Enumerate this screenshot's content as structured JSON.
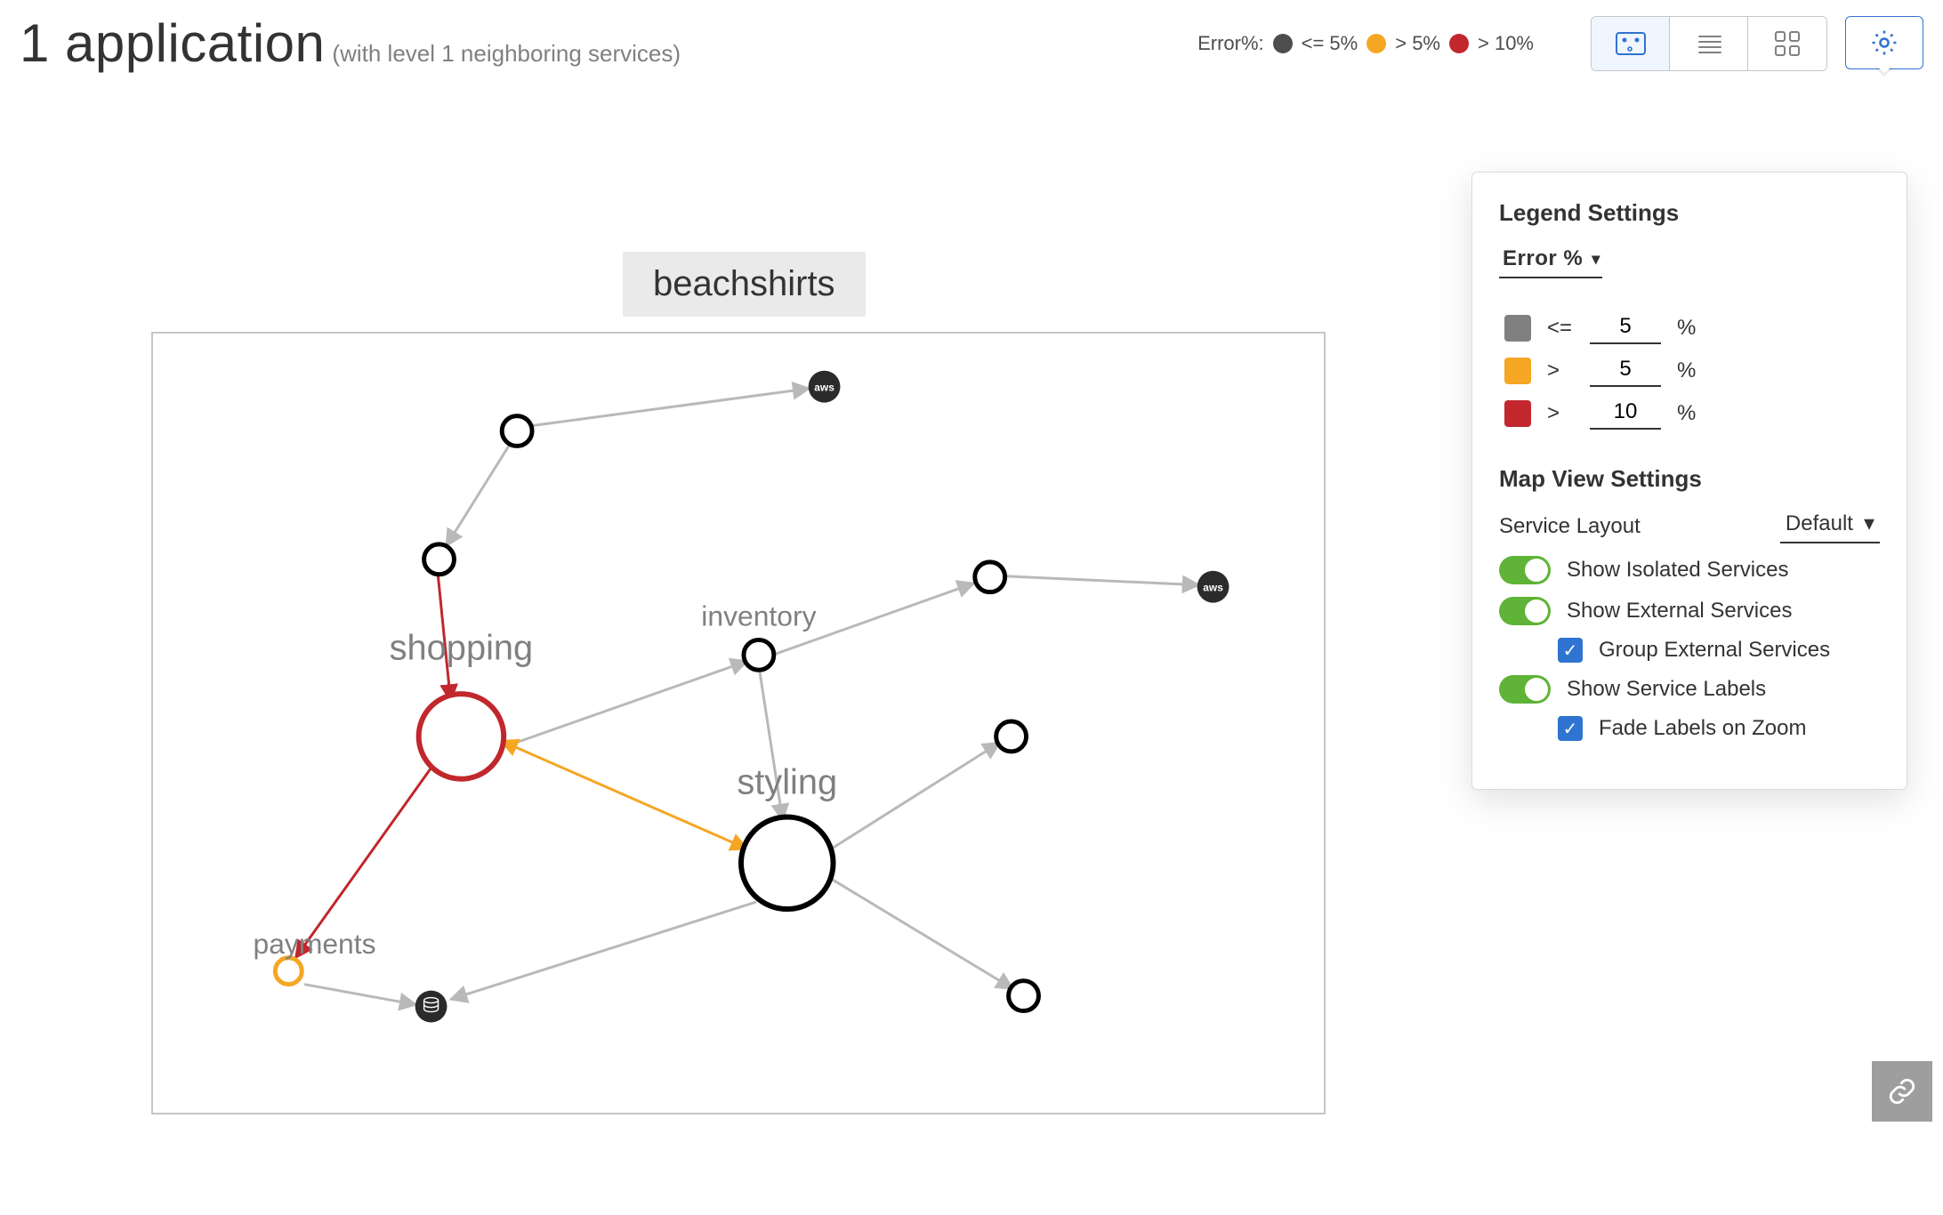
{
  "header": {
    "title_main": "1 application",
    "title_sub": "(with level 1 neighboring services)"
  },
  "legend_top": {
    "label": "Error%:",
    "low": "<= 5%",
    "mid": "> 5%",
    "high": "> 10%"
  },
  "app_box_label": "beachshirts",
  "nodes": {
    "shopping": "shopping",
    "styling": "styling",
    "inventory": "inventory",
    "payments": "payments"
  },
  "popover": {
    "legend_title": "Legend Settings",
    "metric_label": "Error %",
    "thresholds": {
      "low": {
        "op": "<=",
        "value": "5",
        "unit": "%"
      },
      "mid": {
        "op": ">",
        "value": "5",
        "unit": "%"
      },
      "high": {
        "op": ">",
        "value": "10",
        "unit": "%"
      }
    },
    "map_title": "Map View Settings",
    "layout_label": "Service Layout",
    "layout_value": "Default",
    "opt_isolated": "Show Isolated Services",
    "opt_external": "Show External Services",
    "opt_group_ext": "Group External Services",
    "opt_labels": "Show Service Labels",
    "opt_fade": "Fade Labels on Zoom"
  },
  "colors": {
    "low_dot": "#4d4d4d",
    "mid_dot": "#f5a623",
    "high_dot": "#c1272d",
    "edge_grey": "#b9b9b9",
    "edge_orange": "#f5a623",
    "edge_red": "#c1272d"
  }
}
